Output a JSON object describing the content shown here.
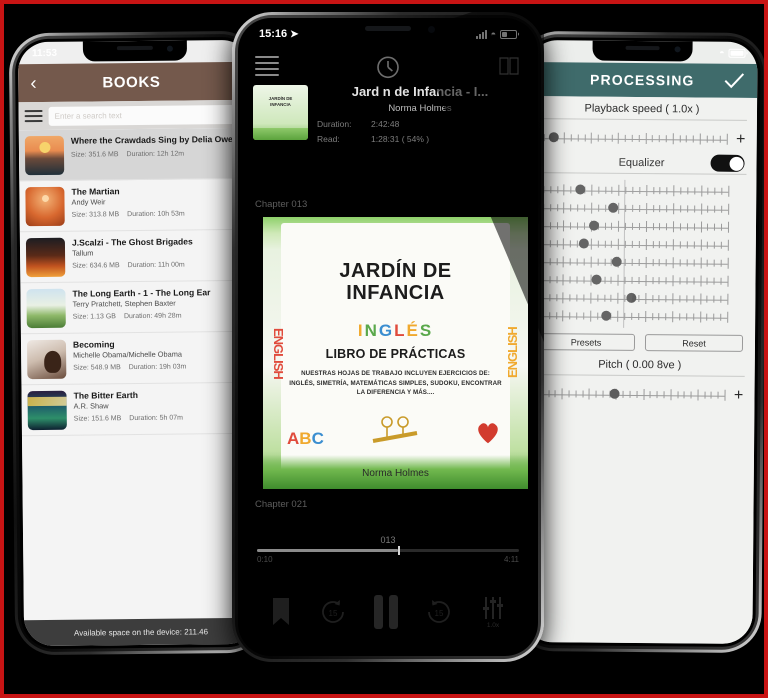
{
  "frame": {
    "accent_color": "#c81414",
    "background_color": "#000000"
  },
  "left_phone": {
    "status_bar": {
      "time": "11:53"
    },
    "navbar": {
      "back_icon": "chevron-left-icon",
      "title": "BOOKS"
    },
    "search": {
      "placeholder": "Enter a search text",
      "menu_icon": "hamburger-icon"
    },
    "books": [
      {
        "title": "Where the Crawdads Sing by Delia Owens",
        "author": "",
        "size_label": "Size: 351.6 MB",
        "duration_label": "Duration: 12h 12m",
        "selected": true,
        "cover_class": "c-crawdads"
      },
      {
        "title": "The Martian",
        "author": "Andy Weir",
        "size_label": "Size: 313.8 MB",
        "duration_label": "Duration: 10h 53m",
        "selected": false,
        "cover_class": "c-martian"
      },
      {
        "title": "J.Scalzi - The Ghost Brigades",
        "author": "Tallum",
        "size_label": "Size: 634.6 MB",
        "duration_label": "Duration: 11h 00m",
        "selected": false,
        "cover_class": "c-ghost"
      },
      {
        "title": "The Long Earth - 1 - The Long Ear",
        "author": "Terry Pratchett, Stephen Baxter",
        "size_label": "Size: 1.13 GB",
        "duration_label": "Duration: 49h 28m",
        "selected": false,
        "cover_class": "c-longearth"
      },
      {
        "title": "Becoming",
        "author": "Michelle Obama/Michelle Obama",
        "size_label": "Size: 548.9 MB",
        "duration_label": "Duration: 19h 03m",
        "selected": false,
        "cover_class": "c-becoming"
      },
      {
        "title": "The Bitter Earth",
        "author": "A.R. Shaw",
        "size_label": "Size: 151.6 MB",
        "duration_label": "Duration: 5h 07m",
        "selected": false,
        "cover_class": "c-bitter"
      }
    ],
    "footer": {
      "text": "Available space on the device: 211.46"
    }
  },
  "center_phone": {
    "status_bar": {
      "time": "15:16",
      "location_icon": "location-arrow-icon",
      "signal_icon": "signal-bars-icon",
      "wifi_icon": "wifi-icon",
      "battery_icon": "battery-icon"
    },
    "toolbar": {
      "menu_icon": "hamburger-icon",
      "sleep_timer_icon": "timer-icon",
      "book_icon": "book-icon"
    },
    "now_playing": {
      "title": "Jard   n de Infancia - I...",
      "author": "Norma Holmes",
      "duration_key": "Duration:",
      "duration_value": "2:42:48",
      "read_key": "Read:",
      "read_value": "1:28:31 ( 54% )"
    },
    "chapter_top": "Chapter 013",
    "chapter_bottom": "Chapter 021",
    "cover": {
      "side_letters": "ENGLISH",
      "title_line1": "JARDÍN DE",
      "title_line2": "INFANCIA",
      "sub_letters": [
        "I",
        "N",
        "G",
        "L",
        "É",
        "S"
      ],
      "sub2": "LIBRO DE PRÁCTICAS",
      "body": "NUESTRAS HOJAS DE TRABAJO INCLUYEN EJERCICIOS DE: INGLÉS, SIMETRÍA, MATEMÁTICAS SIMPLES, SUDOKU, ENCONTRAR LA DIFERENCIA Y MÁS....",
      "abc": [
        "A",
        "B",
        "C"
      ],
      "author": "Norma Holmes"
    },
    "seek": {
      "value": "013",
      "time_left": "0:10",
      "time_right": "4:11",
      "progress_percent": 54
    },
    "controls": [
      {
        "name": "bookmark-button",
        "icon": "bookmark-icon",
        "sub": ""
      },
      {
        "name": "rewind-button",
        "icon": "rewind-15-icon",
        "sub": "15"
      },
      {
        "name": "pause-button",
        "icon": "pause-icon",
        "sub": ""
      },
      {
        "name": "forward-button",
        "icon": "forward-15-icon",
        "sub": "15"
      },
      {
        "name": "equalizer-button",
        "icon": "equalizer-icon",
        "sub": "1.0x"
      }
    ]
  },
  "right_phone": {
    "status_bar": {
      "wifi_icon": "wifi-icon",
      "battery_icon": "battery-icon"
    },
    "navbar": {
      "title": "PROCESSING",
      "confirm_icon": "checkmark-icon"
    },
    "playback_speed": {
      "label": "Playback speed ( 1.0x )",
      "knob_percent": 9,
      "plus_label": "+"
    },
    "equalizer": {
      "label": "Equalizer",
      "enabled": true,
      "band_percents": [
        23,
        40,
        30,
        25,
        42,
        32,
        50,
        37
      ]
    },
    "buttons": {
      "presets": "Presets",
      "reset": "Reset"
    },
    "pitch": {
      "label": "Pitch ( 0.00 8ve )",
      "knob_percent": 42,
      "plus_label": "+"
    }
  }
}
